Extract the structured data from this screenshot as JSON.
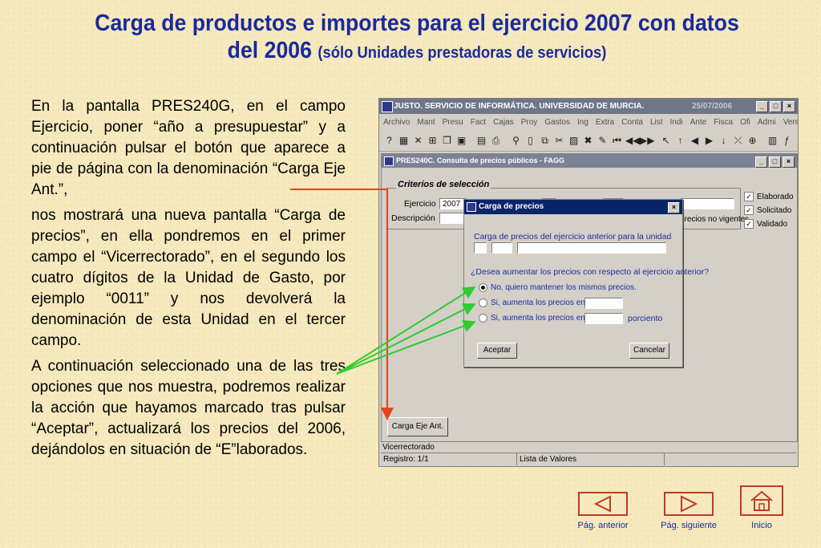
{
  "title": {
    "main": "Carga de productos e importes para el ejercicio 2007 con datos del 2006",
    "note": "(sólo Unidades prestadoras de servicios)"
  },
  "paragraphs": [
    "En la pantalla PRES240G, en el campo Ejercicio, poner “año a presupuestar” y a continuación pulsar el botón que aparece a pie de página con la denominación “Carga Eje Ant.”,",
    "nos mostrará una nueva pantalla “Carga de precios”, en ella pondremos en el primer campo el “Vicerrectorado”, en el segundo los cuatro dígitos de la Unidad de Gasto, por ejemplo “0011” y nos devolverá la denominación de esta Unidad en el tercer campo.",
    "A continuación seleccionado una de las tres opciones que nos muestra, podremos realizar la acción que hayamos marcado tras pulsar “Aceptar”, actualizará los precios del 2006, dejándolos en situación de “E”laborados."
  ],
  "app": {
    "title": "JUSTO. SERVICIO DE INFORMÁTICA. UNIVERSIDAD DE MURCIA.",
    "date": "25/07/2006",
    "menu": [
      "Archivo",
      "Mant",
      "Presu",
      "Fact",
      "Cajas",
      "Proy",
      "Gastos",
      "Ing",
      "Extra",
      "Conta",
      "List",
      "Indi",
      "Ante",
      "Fisca",
      "Ofi",
      "Admi",
      "Ventana"
    ],
    "window_title": "PRES240C. Consulta de precios públicos - FAGG",
    "criteria_label": "Criterios de selección",
    "ejercicio_label": "Ejercicio",
    "ejercicio_value": "2007",
    "descripcion_label": "Descripción",
    "checks": [
      "Elaborado",
      "Solicitado",
      "Validado"
    ],
    "no_vigentes_label": "precios no vigentes",
    "carga_button": "Carga Eje Ant.",
    "status_field": "Vicerrectorado",
    "status_record": "Registro: 1/1",
    "status_list": "Lista de Valores"
  },
  "dialog": {
    "title": "Carga de precios",
    "heading": "Carga de precios del ejercicio anterior para la unidad",
    "question": "¿Desea aumentar los precios con respecto al ejercicio anterior?",
    "opt1": "No, quiero mantener los mismos precios.",
    "opt2": "Si, aumenta los precios en",
    "opt3": "Si, aumenta los precios en un",
    "percent_label": "porciento",
    "accept": "Aceptar",
    "cancel": "Cancelar"
  },
  "nav": {
    "prev": "Pág. anterior",
    "next": "Pág. siguiente",
    "home": "Inicio"
  },
  "colors": {
    "title_blue": "#1a2a9c",
    "arrow_red": "#e8421a",
    "arrow_green": "#2ecc2e"
  }
}
